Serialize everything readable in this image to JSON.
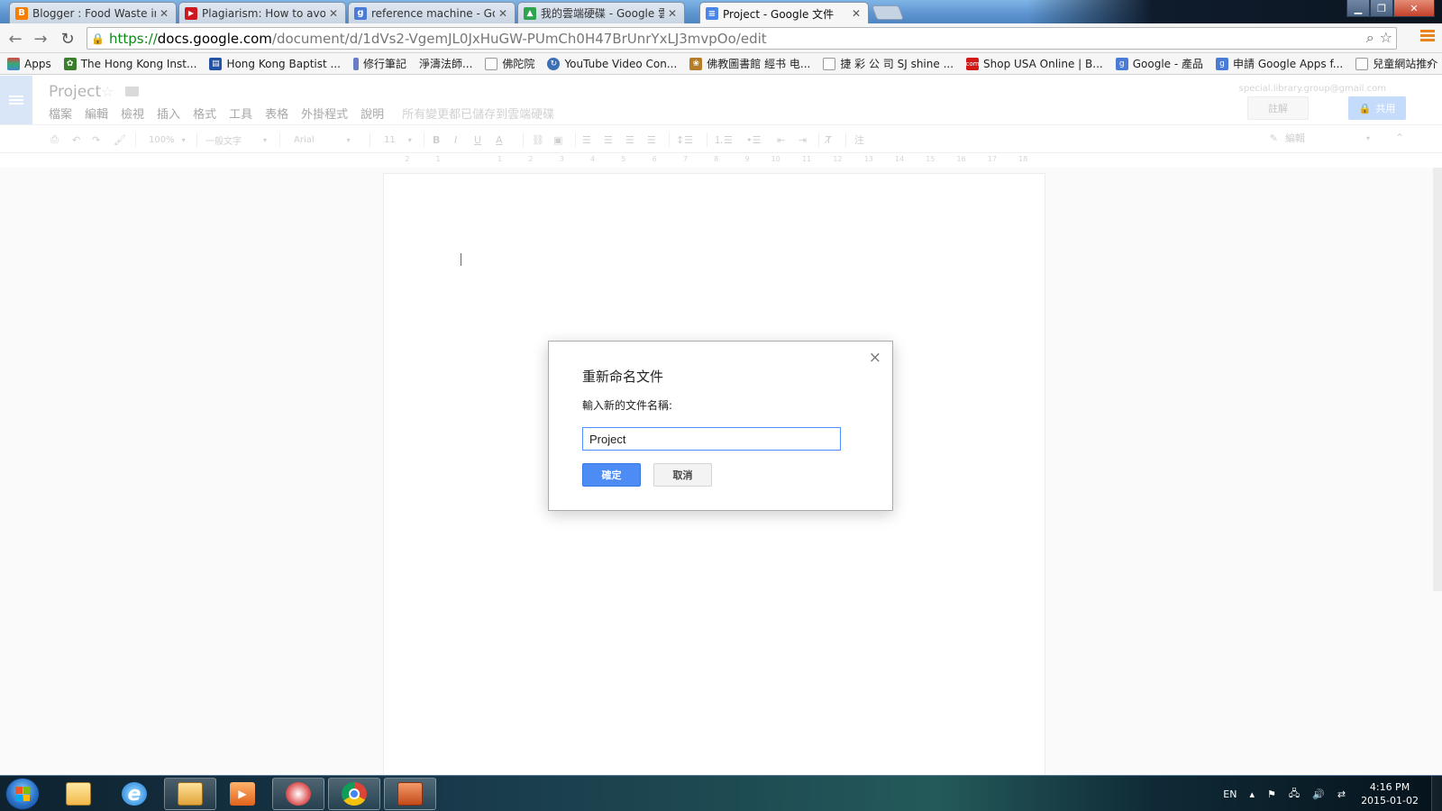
{
  "browser": {
    "tabs": [
      {
        "title": "Blogger : Food Waste in H",
        "icon": "blogger-icon",
        "color": "#f57d00",
        "glyph": "B"
      },
      {
        "title": "Plagiarism: How to avoid i",
        "icon": "youtube-icon",
        "color": "#cc181e",
        "glyph": "▶"
      },
      {
        "title": "reference machine - Goog",
        "icon": "google-icon",
        "color": "#4a7bd6",
        "glyph": "g"
      },
      {
        "title": "我的雲端硬碟 - Google 雲",
        "icon": "drive-icon",
        "color": "#2fa44f",
        "glyph": "▲"
      },
      {
        "title": "Project - Google 文件",
        "icon": "docs-icon",
        "color": "#4a86e8",
        "glyph": "≡"
      }
    ],
    "url": {
      "scheme": "https://",
      "host": "docs.google.com",
      "path": "/document/d/1dVs2-VgemJL0JxHuGW-PUmCh0H47BrUnrYxLJ3mvpOo/edit"
    },
    "bookmarks": [
      {
        "label": "Apps",
        "icon": "apps-grid-icon",
        "color": "#d44"
      },
      {
        "label": "The Hong Kong Inst...",
        "icon": "leaf-icon",
        "color": "#3a7d2c"
      },
      {
        "label": "Hong Kong Baptist ...",
        "icon": "book-icon",
        "color": "#2452a4"
      },
      {
        "label": "修行筆記",
        "icon": "bookmark-icon",
        "color": "#6a7cc4"
      },
      {
        "label": "淨濤法師...",
        "icon": "none",
        "color": ""
      },
      {
        "label": "佛陀院",
        "icon": "page-icon",
        "color": "#999"
      },
      {
        "label": "YouTube Video Con...",
        "icon": "refresh-icon",
        "color": "#3b6fb6"
      },
      {
        "label": "佛教圖書館 經书 电...",
        "icon": "lotus-icon",
        "color": "#b57c2a"
      },
      {
        "label": "捷 彩 公 司 SJ shine ...",
        "icon": "page-icon",
        "color": "#999"
      },
      {
        "label": "Shop USA Online | B...",
        "icon": "store-icon",
        "color": "#d31818"
      },
      {
        "label": "Google - 產品",
        "icon": "google-icon",
        "color": "#4a7bd6"
      },
      {
        "label": "申請 Google Apps f...",
        "icon": "google-icon",
        "color": "#4a7bd6"
      },
      {
        "label": "兒童網站推介",
        "icon": "page-icon",
        "color": "#999"
      }
    ],
    "bookmarks_more": "»"
  },
  "docs": {
    "title": "Project",
    "menu": [
      "檔案",
      "編輯",
      "檢視",
      "插入",
      "格式",
      "工具",
      "表格",
      "外掛程式",
      "說明"
    ],
    "save_status": "所有變更都已儲存到雲端硬碟",
    "account": "special.library.group@gmail.com",
    "comment_label": "註解",
    "share_label": "共用",
    "toolbar": {
      "zoom": "100%",
      "style": "一般文字",
      "font": "Arial",
      "size": "11",
      "edit_mode": "編輯"
    },
    "ruler": [
      "2",
      "1",
      "",
      "1",
      "2",
      "3",
      "4",
      "5",
      "6",
      "7",
      "8",
      "9",
      "10",
      "11",
      "12",
      "13",
      "14",
      "15",
      "16",
      "17",
      "18"
    ]
  },
  "dialog": {
    "title": "重新命名文件",
    "label": "輸入新的文件名稱:",
    "input_value": "Project",
    "ok_label": "確定",
    "cancel_label": "取消",
    "close_glyph": "×"
  },
  "taskbar": {
    "language": "EN",
    "time": "4:16 PM",
    "date": "2015-01-02"
  }
}
